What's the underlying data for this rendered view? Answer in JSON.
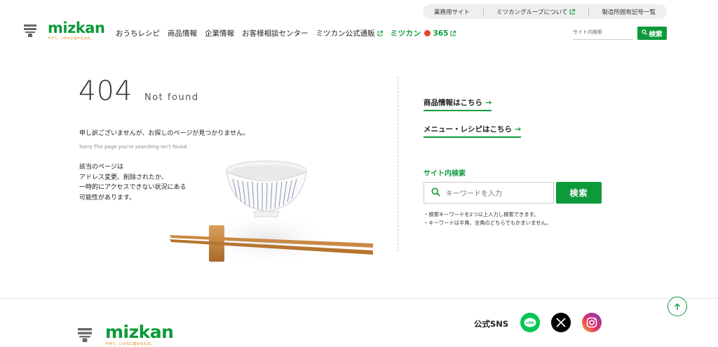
{
  "utility_nav": {
    "items": [
      {
        "label": "業務用サイト",
        "external": false
      },
      {
        "label": "ミツカングループについて",
        "external": true
      },
      {
        "label": "製造所固有記号一覧",
        "external": false
      }
    ]
  },
  "header": {
    "logo_text": "mizkan",
    "logo_tagline": "やがて、いのちに変わるもの。",
    "nav": [
      {
        "label": "おうちレシピ"
      },
      {
        "label": "商品情報"
      },
      {
        "label": "企業情報"
      },
      {
        "label": "お客様相談センター"
      },
      {
        "label": "ミツカン公式通販",
        "external": true
      },
      {
        "label_prefix": "ミツカン",
        "label_suffix": "365",
        "external": true
      }
    ],
    "search_placeholder": "サイト内検索",
    "search_button": "検索"
  },
  "error": {
    "code": "404",
    "status": "Not found",
    "message_jp": "申し訳ございませんが、お探しのページが見つかりません。",
    "message_en": "Sorry The page you're searching isn't found.",
    "detail_lines": [
      "該当のページは",
      "アドレス変更、削除されたか、",
      "一時的にアクセスできない状況にある",
      "可能性があります。"
    ]
  },
  "links": {
    "products": "商品情報はこちら",
    "recipes": "メニュー・レシピはこちら",
    "arrow": "→"
  },
  "site_search": {
    "title": "サイト内検索",
    "placeholder": "キーワードを入力",
    "button": "検索",
    "notes": [
      "・検索キーワードを2つ以上入力し検索できます。",
      "・キーワードは半角、全角のどちらでもかまいません。"
    ]
  },
  "footer": {
    "logo_text": "mizkan",
    "logo_tagline": "やがて、いのちに変わるもの。",
    "sns_label": "公式SNS",
    "sns": [
      {
        "name": "LINE",
        "label": "LINE"
      },
      {
        "name": "X",
        "label": "𝕏"
      },
      {
        "name": "Instagram",
        "label": ""
      }
    ]
  },
  "colors": {
    "brand_green": "#0d9a3b",
    "tagline_orange": "#e07c00",
    "line_green": "#06c755"
  },
  "icons": {
    "page_top": "arrow-up-icon",
    "external": "external-link-icon",
    "search": "search-icon"
  }
}
